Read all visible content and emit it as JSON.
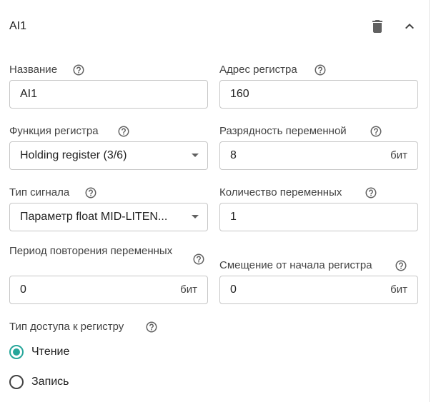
{
  "header": {
    "title": "AI1",
    "delete_icon": "trash-icon",
    "collapse_icon": "chevron-up-icon"
  },
  "fields": {
    "name": {
      "label": "Название",
      "value": "AI1"
    },
    "register_address": {
      "label": "Адрес регистра",
      "value": "160"
    },
    "register_function": {
      "label": "Функция регистра",
      "value": "Holding register (3/6)"
    },
    "variable_bits": {
      "label": "Разрядность переменной",
      "value": "8",
      "unit": "бит"
    },
    "signal_type": {
      "label": "Тип сигнала",
      "value": "Параметр float MID-LITEN..."
    },
    "variable_count": {
      "label": "Количество переменных",
      "value": "1"
    },
    "repeat_period": {
      "label": "Период повторения переменных",
      "value": "0",
      "unit": "бит"
    },
    "register_offset": {
      "label": "Смещение от начала регистра",
      "value": "0",
      "unit": "бит"
    }
  },
  "access": {
    "label": "Тип доступа к регистру",
    "options": [
      {
        "label": "Чтение",
        "selected": true
      },
      {
        "label": "Запись",
        "selected": false
      }
    ]
  },
  "colors": {
    "accent": "#26a69a",
    "border": "#c6c6c6",
    "text": "#212121",
    "icon": "#616161"
  }
}
